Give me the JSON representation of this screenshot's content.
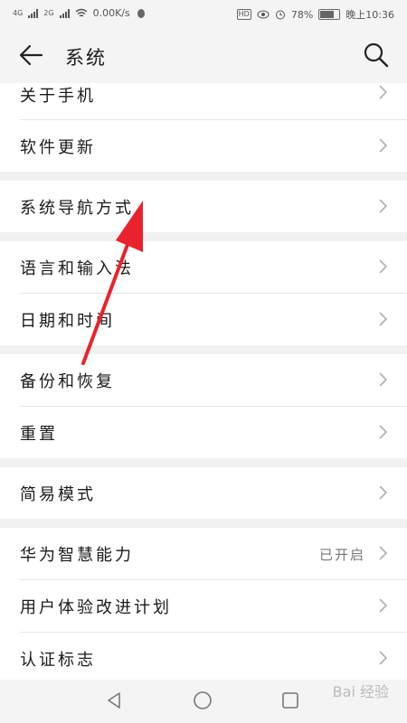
{
  "status_bar": {
    "net1": "4G",
    "net2": "2G",
    "speed": "0.00K/s",
    "battery": "78%",
    "time": "晚上10:36",
    "hd": "HD"
  },
  "header": {
    "title": "系统"
  },
  "groups": [
    {
      "items": [
        {
          "label": "关于手机"
        },
        {
          "label": "软件更新"
        }
      ]
    },
    {
      "items": [
        {
          "label": "系统导航方式"
        }
      ]
    },
    {
      "items": [
        {
          "label": "语言和输入法"
        },
        {
          "label": "日期和时间"
        }
      ]
    },
    {
      "items": [
        {
          "label": "备份和恢复"
        },
        {
          "label": "重置"
        }
      ]
    },
    {
      "items": [
        {
          "label": "简易模式"
        }
      ]
    },
    {
      "items": [
        {
          "label": "华为智慧能力",
          "value": "已开启"
        },
        {
          "label": "用户体验改进计划"
        },
        {
          "label": "认证标志"
        }
      ]
    }
  ],
  "watermark": "Bai 经验",
  "colors": {
    "arrow": "#e8232d",
    "chevron": "#b0b0b0"
  },
  "icons": [
    "back-arrow-icon",
    "search-icon",
    "chevron-right-icon",
    "nav-back-icon",
    "nav-home-icon",
    "nav-recent-icon"
  ]
}
